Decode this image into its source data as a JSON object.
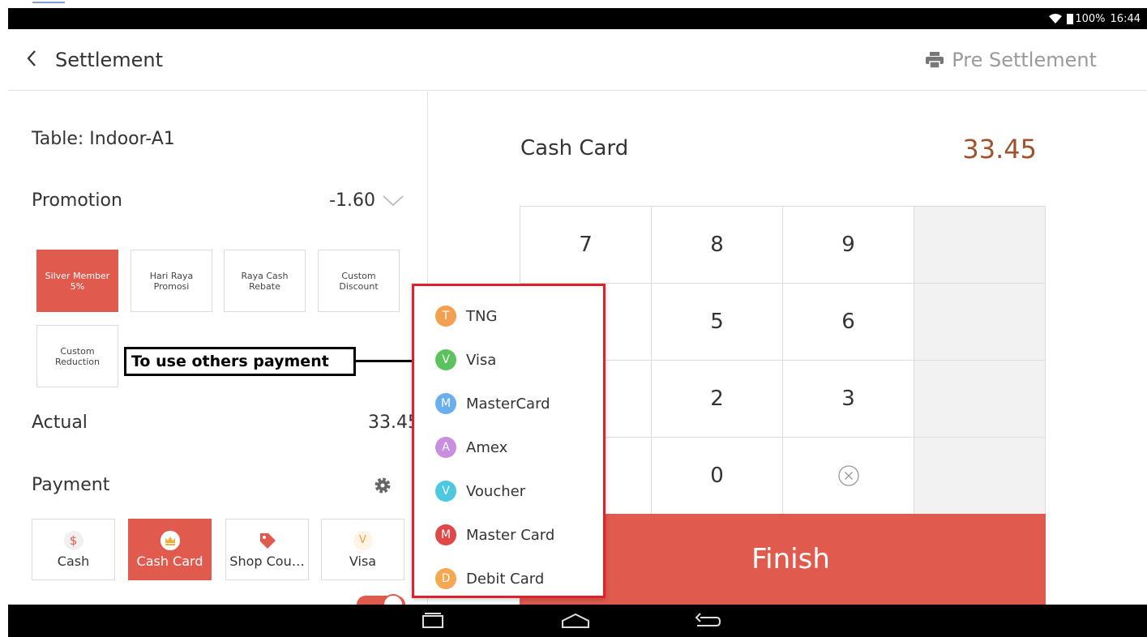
{
  "status_bar": {
    "battery": "100%",
    "time": "16:44"
  },
  "header": {
    "title": "Settlement",
    "pre_settlement_label": "Pre Settlement"
  },
  "left": {
    "table_label": "Table:  Indoor-A1",
    "promotion_label": "Promotion",
    "promotion_value": "-1.60",
    "promotions": [
      {
        "label": "Silver Member 5%",
        "active": true
      },
      {
        "label": "Hari Raya Promosi",
        "active": false
      },
      {
        "label": "Raya Cash Rebate",
        "active": false
      },
      {
        "label": "Custom Discount",
        "active": false
      },
      {
        "label": "Custom Reduction",
        "active": false
      }
    ],
    "actual_label": "Actual",
    "actual_value": "33.45",
    "payment_label": "Payment",
    "payments": [
      {
        "label": "Cash",
        "icon": "$",
        "icon_color": "#e05a4e"
      },
      {
        "label": "Cash Card",
        "icon": "crown",
        "active": true
      },
      {
        "label": "Shop Cou…",
        "icon": "tag-icon",
        "icon_color": "#e05a4e"
      },
      {
        "label": "Visa",
        "icon": "V",
        "icon_color": "#f0a040"
      }
    ]
  },
  "right": {
    "method_name": "Cash Card",
    "amount": "33.45",
    "keys": {
      "k7": "7",
      "k8": "8",
      "k9": "9",
      "k5": "5",
      "k6": "6",
      "k2": "2",
      "k3": "3",
      "k0": "0"
    },
    "finish_label": "Finish"
  },
  "popup": {
    "items": [
      {
        "letter": "T",
        "label": "TNG",
        "color": "#f5a050"
      },
      {
        "letter": "V",
        "label": "Visa",
        "color": "#5cc35c"
      },
      {
        "letter": "M",
        "label": "MasterCard",
        "color": "#6aaef0"
      },
      {
        "letter": "A",
        "label": "Amex",
        "color": "#c88ee0"
      },
      {
        "letter": "V",
        "label": "Voucher",
        "color": "#4cc8e0"
      },
      {
        "letter": "M",
        "label": "Master Card",
        "color": "#e04848"
      },
      {
        "letter": "D",
        "label": "Debit Card",
        "color": "#f5a850"
      }
    ]
  },
  "annotation": {
    "text": "To use others payment"
  }
}
